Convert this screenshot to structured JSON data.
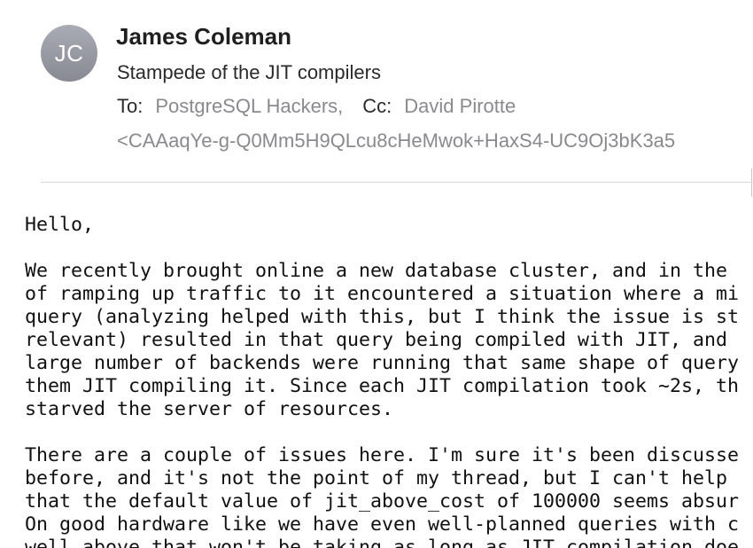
{
  "message": {
    "avatar_initials": "JC",
    "sender_name": "James Coleman",
    "subject": "Stampede of the JIT compilers",
    "to_label": "To:",
    "to_value": "PostgreSQL Hackers,",
    "cc_label": "Cc:",
    "cc_value": "David Pirotte",
    "message_id": "<CAAaqYe-g-Q0Mm5H9QLcu8cHeMwok+HaxS4-UC9Oj3bK3a5"
  },
  "body_lines": [
    "Hello,",
    "",
    "We recently brought online a new database cluster, and in the",
    "of ramping up traffic to it encountered a situation where a mi",
    "query (analyzing helped with this, but I think the issue is st",
    "relevant) resulted in that query being compiled with JIT, and",
    "large number of backends were running that same shape of query",
    "them JIT compiling it. Since each JIT compilation took ~2s, th",
    "starved the server of resources.",
    "",
    "There are a couple of issues here. I'm sure it's been discusse",
    "before, and it's not the point of my thread, but I can't help",
    "that the default value of jit_above_cost of 100000 seems absur",
    "On good hardware like we have even well-planned queries with c",
    "well above that won't be taking as long as JIT compilation doe"
  ]
}
